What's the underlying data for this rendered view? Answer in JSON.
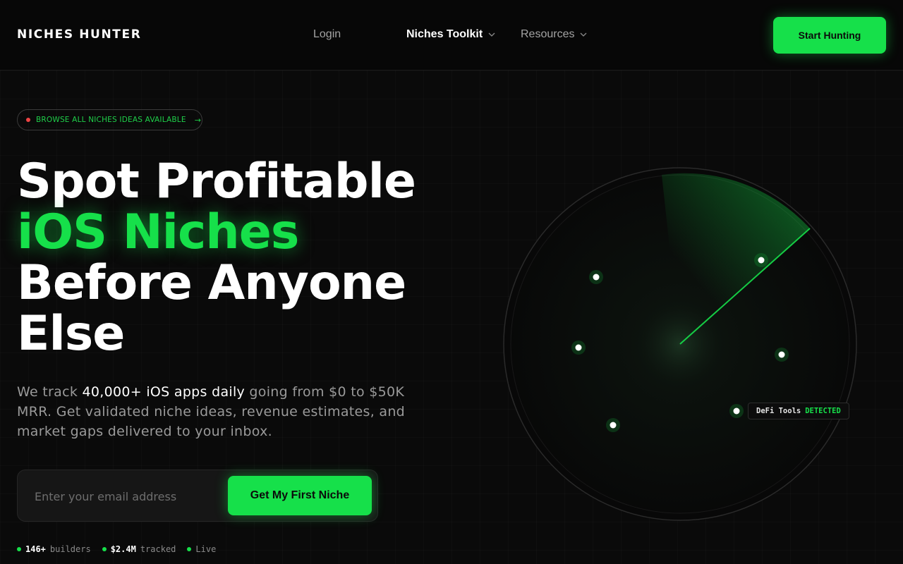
{
  "header": {
    "logo": "NICHES HUNTER",
    "nav": {
      "login": "Login",
      "toolkit": "Niches Toolkit",
      "resources": "Resources"
    },
    "cta": "Start Hunting"
  },
  "hero": {
    "pill": "BROWSE ALL NICHES IDEAS AVAILABLE",
    "pill_arrow": "→",
    "title_line1": "Spot Profitable",
    "title_line2": "iOS Niches",
    "title_line3": "Before Anyone",
    "title_line4": "Else",
    "desc_pre": "We track ",
    "desc_bold": "40,000+ iOS apps daily",
    "desc_post": " going from $0 to $50K MRR. Get validated niche ideas, revenue estimates, and market gaps delivered to your inbox.",
    "email_placeholder": "Enter your email address",
    "email_cta": "Get My First Niche"
  },
  "stats": [
    {
      "value": "146+",
      "label": "builders"
    },
    {
      "value": "$2.4M",
      "label": "tracked"
    },
    {
      "value": "",
      "label": "Live"
    }
  ],
  "radar": {
    "tag_name": "DeFi Tools",
    "tag_status": "DETECTED"
  },
  "colors": {
    "accent": "#16e04a",
    "background": "#0a0a0a",
    "live_dot_red": "#ef4444"
  },
  "icons": [
    "chevron-down-icon",
    "arrow-right-icon",
    "status-dot-icon",
    "radar-icon"
  ]
}
